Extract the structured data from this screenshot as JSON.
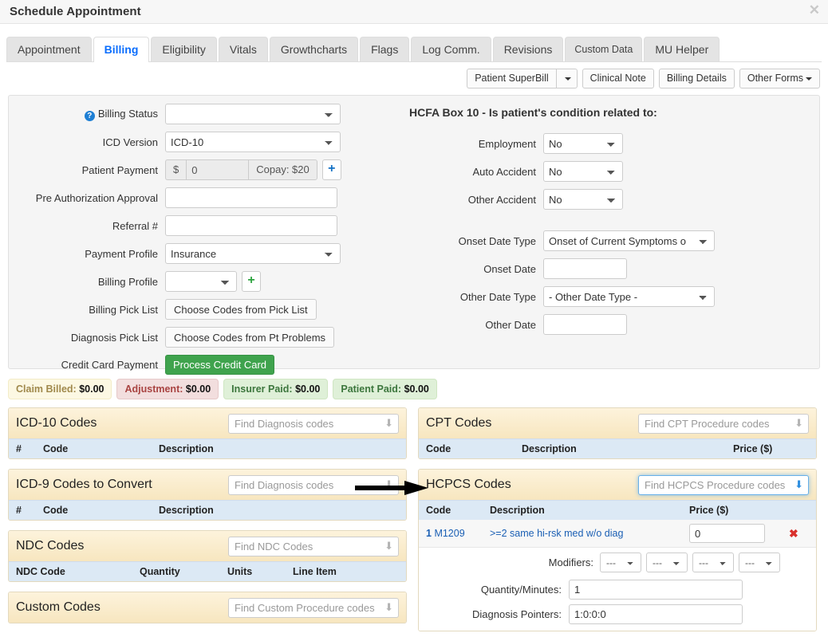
{
  "modal": {
    "title": "Schedule Appointment",
    "close_icon": "close-icon"
  },
  "tabs": [
    {
      "label": "Appointment",
      "active": false
    },
    {
      "label": "Billing",
      "active": true
    },
    {
      "label": "Eligibility",
      "active": false
    },
    {
      "label": "Vitals",
      "active": false
    },
    {
      "label": "Growthcharts",
      "active": false
    },
    {
      "label": "Flags",
      "active": false
    },
    {
      "label": "Log Comm.",
      "active": false
    },
    {
      "label": "Revisions",
      "active": false
    },
    {
      "label": "Custom Data",
      "active": false,
      "small": true
    },
    {
      "label": "MU Helper",
      "active": false
    }
  ],
  "toolbar": {
    "superbill_label": "Patient SuperBill",
    "superbill_caret": "caret-down-icon",
    "clinical_note_label": "Clinical Note",
    "billing_details_label": "Billing Details",
    "other_forms_label": "Other Forms"
  },
  "form": {
    "left": {
      "billing_status_label": "Billing Status",
      "billing_status_help": "?",
      "billing_status_value": "",
      "icd_version_label": "ICD Version",
      "icd_version_value": "ICD-10",
      "patient_payment_label": "Patient Payment",
      "patient_payment_currency": "$",
      "patient_payment_value": "0",
      "copay_label": "Copay: $20",
      "patient_payment_add": "+",
      "pre_auth_label": "Pre Authorization Approval",
      "pre_auth_value": "",
      "referral_label": "Referral #",
      "referral_value": "",
      "payment_profile_label": "Payment Profile",
      "payment_profile_value": "Insurance",
      "billing_profile_label": "Billing Profile",
      "billing_profile_value": "",
      "billing_profile_add": "+",
      "billing_pick_label": "Billing Pick List",
      "billing_pick_button": "Choose Codes from Pick List",
      "diagnosis_pick_label": "Diagnosis Pick List",
      "diagnosis_pick_button": "Choose Codes from Pt Problems",
      "credit_card_label": "Credit Card Payment",
      "credit_card_button": "Process Credit Card"
    },
    "right": {
      "hcfa_title": "HCFA Box 10 - Is patient's condition related to:",
      "employment_label": "Employment",
      "employment_value": "No",
      "auto_accident_label": "Auto Accident",
      "auto_accident_value": "No",
      "other_accident_label": "Other Accident",
      "other_accident_value": "No",
      "onset_date_type_label": "Onset Date Type",
      "onset_date_type_value": "Onset of Current Symptoms o",
      "onset_date_label": "Onset Date",
      "onset_date_value": "",
      "other_date_type_label": "Other Date Type",
      "other_date_type_value": "- Other Date Type -",
      "other_date_label": "Other Date",
      "other_date_value": ""
    }
  },
  "badges": [
    {
      "label": "Claim Billed:",
      "amount": "$0.00",
      "kind": "billed"
    },
    {
      "label": "Adjustment:",
      "amount": "$0.00",
      "kind": "adjust"
    },
    {
      "label": "Insurer Paid:",
      "amount": "$0.00",
      "kind": "insurer"
    },
    {
      "label": "Patient Paid:",
      "amount": "$0.00",
      "kind": "patient"
    }
  ],
  "panels": {
    "icd10": {
      "title": "ICD-10 Codes",
      "search_placeholder": "Find Diagnosis codes",
      "search_value": "",
      "columns": [
        "#",
        "Code",
        "Description"
      ]
    },
    "icd9": {
      "title": "ICD-9 Codes to Convert",
      "search_placeholder": "Find Diagnosis codes",
      "search_value": "",
      "columns": [
        "#",
        "Code",
        "Description"
      ]
    },
    "ndc": {
      "title": "NDC Codes",
      "search_placeholder": "Find NDC Codes",
      "search_value": "",
      "columns": [
        "NDC Code",
        "Quantity",
        "Units",
        "Line Item"
      ]
    },
    "custom": {
      "title": "Custom Codes",
      "search_placeholder": "Find Custom Procedure codes",
      "search_value": ""
    },
    "cpt": {
      "title": "CPT Codes",
      "search_placeholder": "Find CPT Procedure codes",
      "search_value": "",
      "columns": [
        "Code",
        "Description",
        "Price ($)"
      ]
    },
    "hcpcs": {
      "title": "HCPCS Codes",
      "search_placeholder": "Find HCPCS Procedure codes",
      "search_value": "",
      "focused": true,
      "columns": [
        "Code",
        "Description",
        "Price ($)"
      ],
      "row": {
        "num": "1",
        "code": "M1209",
        "description": ">=2 same hi-rsk med w/o diag",
        "price": "0",
        "delete_icon": "✖"
      },
      "modifiers_label": "Modifiers:",
      "modifier_values": [
        "---",
        "---",
        "---",
        "---"
      ],
      "quantity_label": "Quantity/Minutes:",
      "quantity_value": "1",
      "pointers_label": "Diagnosis Pointers:",
      "pointers_value": "1:0:0:0"
    }
  },
  "annotation": {
    "arrow": "arrow-right-annotation"
  },
  "colors": {
    "accent_blue": "#0b6efd",
    "panel_header": "#faecc9",
    "table_header": "#dce9f5",
    "green_button": "#3fa34d",
    "focus_blue": "#66afe9",
    "delete_red": "#d9302c"
  }
}
